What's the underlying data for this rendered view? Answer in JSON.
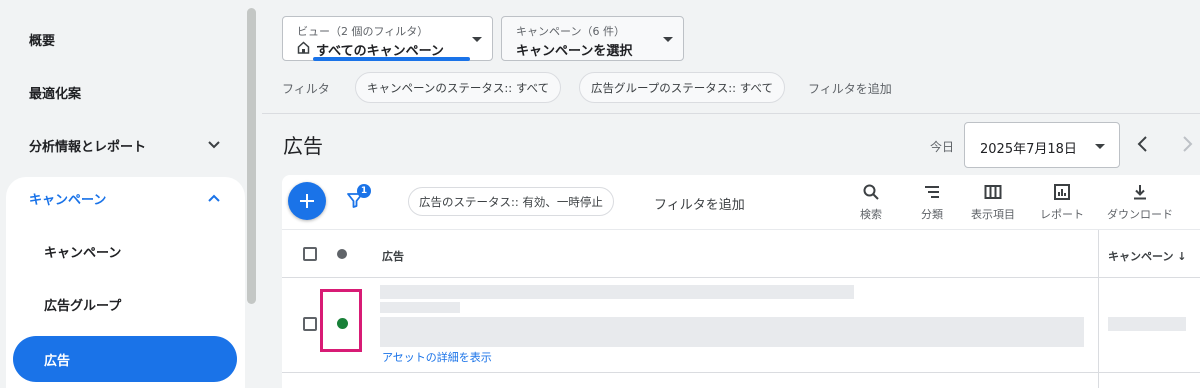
{
  "sidebar": {
    "items": [
      {
        "label": "概要"
      },
      {
        "label": "最適化案"
      },
      {
        "label": "分析情報とレポート"
      },
      {
        "label": "キャンペーン"
      },
      {
        "label": "キャンペーン"
      },
      {
        "label": "広告グループ"
      },
      {
        "label": "広告"
      }
    ]
  },
  "topbar": {
    "view_dropdown": {
      "small": "ビュー（2 個のフィルタ）",
      "value": "すべてのキャンペーン"
    },
    "campaign_dropdown": {
      "small": "キャンペーン（6 件）",
      "value": "キャンペーンを選択"
    },
    "filter_label": "フィルタ",
    "chips": [
      "キャンペーンのステータス:: すべて",
      "広告グループのステータス:: すべて"
    ],
    "add_filter": "フィルタを追加"
  },
  "header": {
    "title": "広告",
    "today_label": "今日",
    "date": "2025年7月18日"
  },
  "toolbar": {
    "filter_badge": "1",
    "status_chip": "広告のステータス:: 有効、一時停止",
    "add_filter": "フィルタを追加",
    "tools": [
      {
        "label": "検索",
        "icon": "search-icon"
      },
      {
        "label": "分類",
        "icon": "segment-icon"
      },
      {
        "label": "表示項目",
        "icon": "columns-icon"
      },
      {
        "label": "レポート",
        "icon": "report-icon"
      },
      {
        "label": "ダウンロード",
        "icon": "download-icon"
      }
    ]
  },
  "table": {
    "headers": {
      "ad": "広告",
      "campaign": "キャンペーン ↓"
    },
    "rows": [
      {
        "status_color": "#188038",
        "link": "アセットの詳細を表示"
      }
    ]
  },
  "colors": {
    "accent": "#1a73e8",
    "highlight": "#d81b75",
    "status_active": "#188038"
  }
}
